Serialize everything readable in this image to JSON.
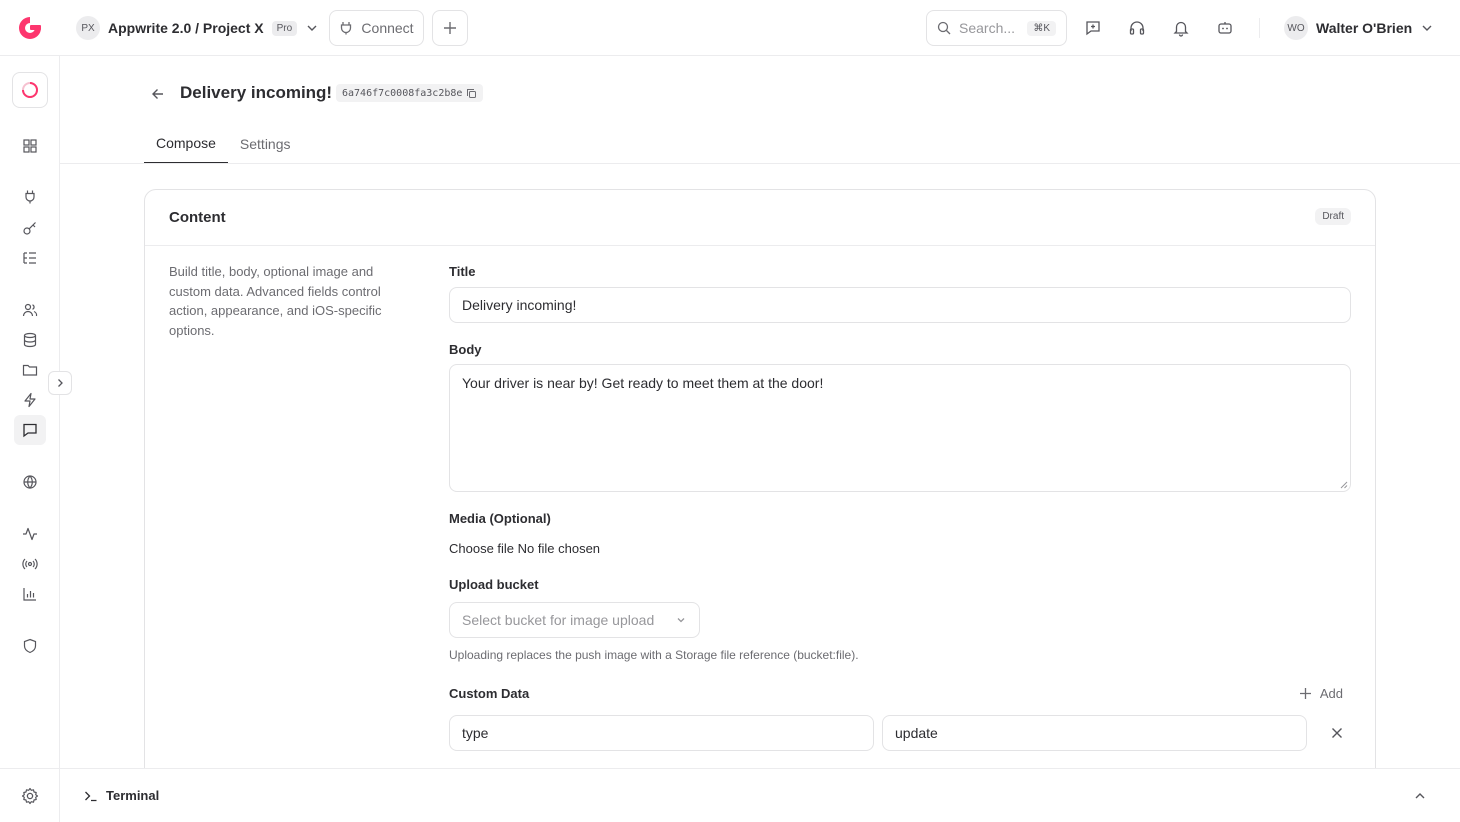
{
  "header": {
    "project_initials": "PX",
    "project_name": "Appwrite 2.0 / Project X",
    "plan_badge": "Pro",
    "connect_label": "Connect",
    "search_placeholder": "Search...",
    "search_shortcut": "⌘K",
    "user_initials": "WO",
    "user_name": "Walter O'Brien"
  },
  "message": {
    "title": "Delivery incoming!",
    "id": "6a746f7c0008fa3c2b8e"
  },
  "tabs": [
    {
      "label": "Compose",
      "active": true
    },
    {
      "label": "Settings",
      "active": false
    }
  ],
  "content_card": {
    "title": "Content",
    "status": "Draft",
    "description": "Build title, body, optional image and custom data. Advanced fields control action, appearance, and iOS-specific options."
  },
  "form": {
    "title_label": "Title",
    "title_value": "Delivery incoming!",
    "body_label": "Body",
    "body_value": "Your driver is near by! Get ready to meet them at the door!",
    "media_label": "Media (Optional)",
    "media_file_text": "Choose file No file chosen",
    "bucket_label": "Upload bucket",
    "bucket_placeholder": "Select bucket for image upload",
    "bucket_helper": "Uploading replaces the push image with a Storage file reference (bucket:file).",
    "custom_data_label": "Custom Data",
    "add_label": "Add",
    "custom_data": [
      {
        "key": "type",
        "value": "update"
      }
    ]
  },
  "terminal": {
    "label": "Terminal"
  },
  "colors": {
    "brand": "#fd366e",
    "text": "#2d2d31",
    "muted": "#6c6c71",
    "border": "#e3e3e5"
  }
}
